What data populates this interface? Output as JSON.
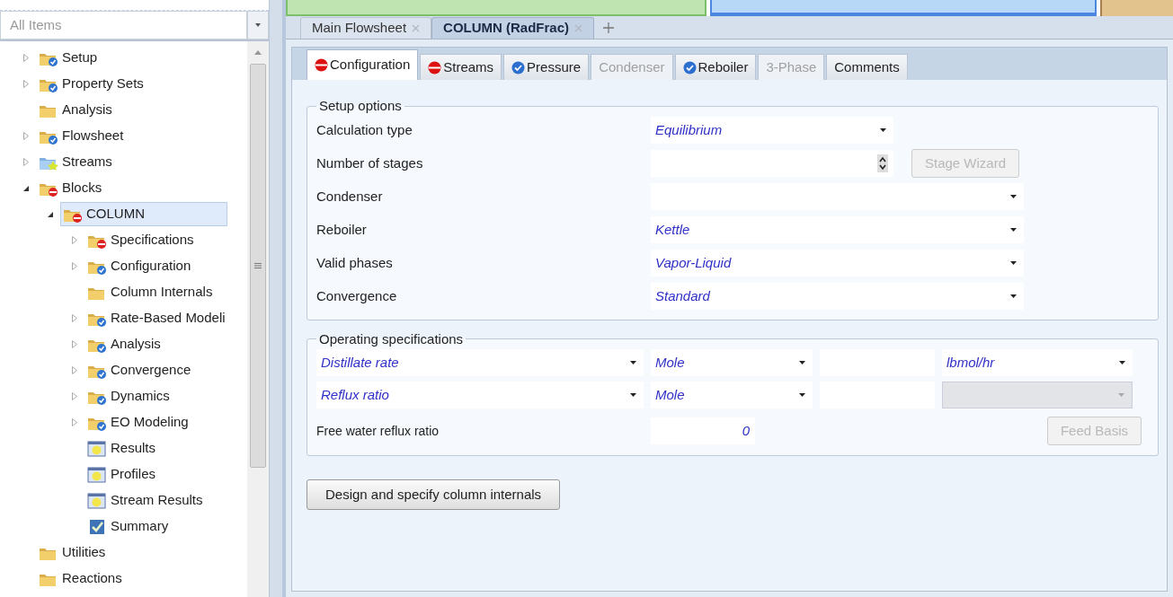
{
  "navigator": {
    "filter": {
      "placeholder": "All Items"
    },
    "tree": [
      {
        "label": "Setup",
        "kind": "folder_check",
        "expanded": false,
        "selected": false
      },
      {
        "label": "Property Sets",
        "kind": "folder_check",
        "expanded": false,
        "selected": false
      },
      {
        "label": "Analysis",
        "kind": "folder",
        "selected": false
      },
      {
        "label": "Flowsheet",
        "kind": "folder_check",
        "expanded": false,
        "selected": false
      },
      {
        "label": "Streams",
        "kind": "folder_streams",
        "expanded": false,
        "selected": false
      },
      {
        "label": "Blocks",
        "kind": "folder_error",
        "expanded": true,
        "selected": false,
        "children": [
          {
            "label": "COLUMN",
            "kind": "folder_error",
            "expanded": true,
            "selected": true,
            "children": [
              {
                "label": "Specifications",
                "kind": "folder_error",
                "expanded": false,
                "selected": false
              },
              {
                "label": "Configuration",
                "kind": "folder_check",
                "expanded": false,
                "selected": false
              },
              {
                "label": "Column Internals",
                "kind": "folder",
                "selected": false
              },
              {
                "label": "Rate-Based Modeli",
                "kind": "folder_check",
                "expanded": false,
                "selected": false
              },
              {
                "label": "Analysis",
                "kind": "folder_check",
                "expanded": false,
                "selected": false
              },
              {
                "label": "Convergence",
                "kind": "folder_check",
                "expanded": false,
                "selected": false
              },
              {
                "label": "Dynamics",
                "kind": "folder_check",
                "expanded": false,
                "selected": false
              },
              {
                "label": "EO Modeling",
                "kind": "folder_check",
                "expanded": false,
                "selected": false
              },
              {
                "label": "Results",
                "kind": "form",
                "selected": false
              },
              {
                "label": "Profiles",
                "kind": "form",
                "selected": false
              },
              {
                "label": "Stream Results",
                "kind": "form",
                "selected": false
              },
              {
                "label": "Summary",
                "kind": "summary",
                "selected": false
              }
            ]
          }
        ]
      },
      {
        "label": "Utilities",
        "kind": "folder",
        "selected": false
      },
      {
        "label": "Reactions",
        "kind": "folder",
        "selected": false
      }
    ]
  },
  "document_tabs": [
    {
      "label": "Main Flowsheet",
      "selected": false
    },
    {
      "label": "COLUMN (RadFrac)",
      "selected": true
    }
  ],
  "form_tabs": [
    {
      "label": "Configuration",
      "kind": "incomplete",
      "selected": true,
      "disabled": false
    },
    {
      "label": "Streams",
      "kind": "incomplete",
      "selected": false,
      "disabled": false
    },
    {
      "label": "Pressure",
      "kind": "complete",
      "selected": false,
      "disabled": false
    },
    {
      "label": "Condenser",
      "kind": "plain",
      "selected": false,
      "disabled": true
    },
    {
      "label": "Reboiler",
      "kind": "complete",
      "selected": false,
      "disabled": false
    },
    {
      "label": "3-Phase",
      "kind": "plain",
      "selected": false,
      "disabled": true
    },
    {
      "label": "Comments",
      "kind": "plain",
      "selected": false,
      "disabled": false
    }
  ],
  "setup_options": {
    "title": "Setup options",
    "rows": [
      {
        "label": "Calculation type",
        "kind": "short_select",
        "value": "Equilibrium"
      },
      {
        "label": "Number of stages",
        "kind": "spin",
        "button": {
          "label": "Stage Wizard",
          "disabled": true
        }
      },
      {
        "label": "Condenser",
        "kind": "select"
      },
      {
        "label": "Reboiler",
        "kind": "select",
        "value": "Kettle"
      },
      {
        "label": "Valid phases",
        "kind": "select",
        "value": "Vapor-Liquid"
      },
      {
        "label": "Convergence",
        "kind": "select",
        "value": "Standard"
      }
    ]
  },
  "operating_specifications": {
    "title": "Operating specifications",
    "rows": [
      {
        "spec": "Distillate rate",
        "basis": "Mole",
        "units": {
          "value": "lbmol/hr",
          "disabled": false
        }
      },
      {
        "spec": "Reflux ratio",
        "basis": "Mole",
        "units": {
          "disabled": true
        }
      }
    ],
    "free_water": {
      "label": "Free water reflux ratio",
      "value": "0"
    },
    "button": {
      "label": "Feed Basis",
      "disabled": true
    }
  },
  "internals_button": {
    "label": "Design and specify column internals"
  }
}
